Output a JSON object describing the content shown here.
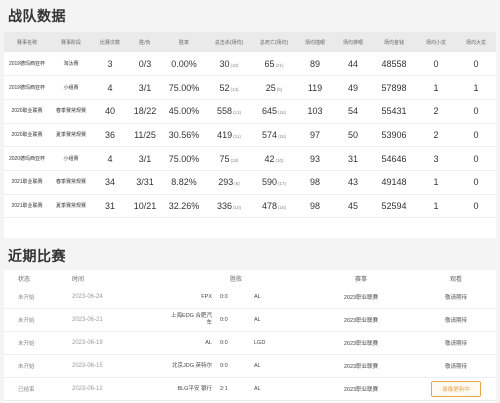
{
  "team_stats": {
    "title": "战队数据",
    "columns": [
      "赛事名称",
      "赛事阶段",
      "比赛次数",
      "胜/负",
      "胜率",
      "总击杀(场均)",
      "总死亡(场均)",
      "场均插眼",
      "场均排眼",
      "场均金钱",
      "场均小龙",
      "场均大龙"
    ],
    "rows": [
      {
        "event": "2019德玛西亚杯",
        "stage": "淘汰赛",
        "matches": "3",
        "wl": "0/3",
        "winrate": "0.00%",
        "kills": "30",
        "kills_avg": "(10)",
        "deaths": "65",
        "deaths_avg": "(21)",
        "wards": "89",
        "clears": "44",
        "gold": "48558",
        "dragons": "0",
        "barons": "0"
      },
      {
        "event": "2019德玛西亚杯",
        "stage": "小组赛",
        "matches": "4",
        "wl": "3/1",
        "winrate": "75.00%",
        "kills": "52",
        "kills_avg": "(13)",
        "deaths": "25",
        "deaths_avg": "(6)",
        "wards": "119",
        "clears": "49",
        "gold": "57898",
        "dragons": "1",
        "barons": "1"
      },
      {
        "event": "2020职业联赛",
        "stage": "春季赛常规赛",
        "matches": "40",
        "wl": "18/22",
        "winrate": "45.00%",
        "kills": "558",
        "kills_avg": "(13)",
        "deaths": "645",
        "deaths_avg": "(16)",
        "wards": "103",
        "clears": "54",
        "gold": "55431",
        "dragons": "2",
        "barons": "0"
      },
      {
        "event": "2020职业联赛",
        "stage": "夏季赛常规赛",
        "matches": "36",
        "wl": "11/25",
        "winrate": "30.56%",
        "kills": "419",
        "kills_avg": "(11)",
        "deaths": "574",
        "deaths_avg": "(15)",
        "wards": "97",
        "clears": "50",
        "gold": "53906",
        "dragons": "2",
        "barons": "0"
      },
      {
        "event": "2020德玛西亚杯",
        "stage": "小组赛",
        "matches": "4",
        "wl": "3/1",
        "winrate": "75.00%",
        "kills": "75",
        "kills_avg": "(18)",
        "deaths": "42",
        "deaths_avg": "(10)",
        "wards": "93",
        "clears": "31",
        "gold": "54646",
        "dragons": "3",
        "barons": "0"
      },
      {
        "event": "2021职业联赛",
        "stage": "春季赛常规赛",
        "matches": "34",
        "wl": "3/31",
        "winrate": "8.82%",
        "kills": "293",
        "kills_avg": "(8)",
        "deaths": "590",
        "deaths_avg": "(17)",
        "wards": "98",
        "clears": "43",
        "gold": "49148",
        "dragons": "1",
        "barons": "0"
      },
      {
        "event": "2021职业联赛",
        "stage": "夏季赛常规赛",
        "matches": "31",
        "wl": "10/21",
        "winrate": "32.26%",
        "kills": "336",
        "kills_avg": "(10)",
        "deaths": "478",
        "deaths_avg": "(15)",
        "wards": "98",
        "clears": "45",
        "gold": "52594",
        "dragons": "1",
        "barons": "0"
      }
    ]
  },
  "recent": {
    "title": "近期比赛",
    "columns": {
      "status": "状态",
      "time": "时间",
      "result": "胜败",
      "event": "赛事",
      "watch": "观看"
    },
    "rows": [
      {
        "status": "未开始",
        "time": "2023-06-24",
        "team1": "FPX",
        "score": "0:0",
        "team2": "AL",
        "event": "2023职业联赛",
        "watch": "敬请期待",
        "active": false
      },
      {
        "status": "未开始",
        "time": "2023-06-21",
        "team1": "上海EDG 合肥汽车",
        "score": "0:0",
        "team2": "AL",
        "event": "2023职业联赛",
        "watch": "敬请期待",
        "active": false
      },
      {
        "status": "未开始",
        "time": "2023-06-19",
        "team1": "AL",
        "score": "0:0",
        "team2": "LGD",
        "event": "2023职业联赛",
        "watch": "敬请期待",
        "active": false
      },
      {
        "status": "未开始",
        "time": "2023-06-15",
        "team1": "北京JDG 英特尔",
        "score": "0:0",
        "team2": "AL",
        "event": "2023职业联赛",
        "watch": "敬请期待",
        "active": false
      },
      {
        "status": "已结束",
        "time": "2023-06-12",
        "team1": "BLG平安 银行",
        "score": "2:1",
        "team2": "AL",
        "event": "2023职业联赛",
        "watch": "录像更新中",
        "active": true
      }
    ]
  },
  "colors": {
    "accent": "#e7a54a",
    "header_bg": "#eaeaea",
    "page_bg": "#f4f4f4"
  }
}
